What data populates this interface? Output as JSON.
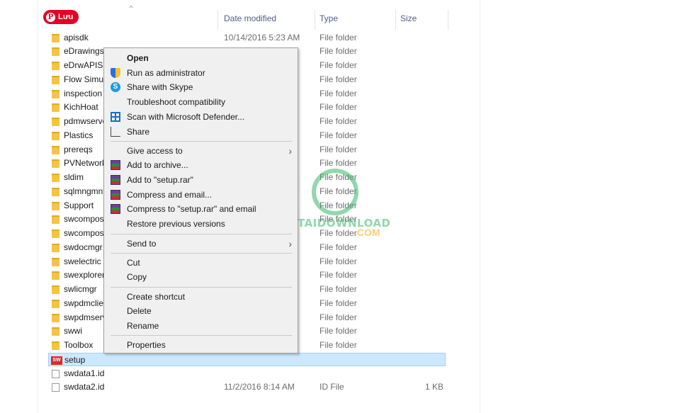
{
  "pin_button": {
    "label": "Lưu"
  },
  "columns": {
    "name": "",
    "date": "Date modified",
    "type": "Type",
    "size": "Size"
  },
  "files": [
    {
      "name": "apisdk",
      "date": "10/14/2016 5:23 AM",
      "type": "File folder",
      "size": "",
      "icon": "folder-icon"
    },
    {
      "name": "eDrawings",
      "date": "",
      "type": "File folder",
      "size": "",
      "icon": "folder-icon"
    },
    {
      "name": "eDrwAPISD",
      "date": "",
      "type": "File folder",
      "size": "",
      "icon": "folder-icon"
    },
    {
      "name": "Flow Simula",
      "date": "",
      "type": "File folder",
      "size": "",
      "icon": "folder-icon"
    },
    {
      "name": "inspection",
      "date": "",
      "type": "File folder",
      "size": "",
      "icon": "folder-icon"
    },
    {
      "name": "KichHoat",
      "date": "",
      "type": "File folder",
      "size": "",
      "icon": "folder-icon"
    },
    {
      "name": "pdmwserve",
      "date": "",
      "type": "File folder",
      "size": "",
      "icon": "folder-icon"
    },
    {
      "name": "Plastics",
      "date": "",
      "type": "File folder",
      "size": "",
      "icon": "folder-icon"
    },
    {
      "name": "prereqs",
      "date": "",
      "type": "File folder",
      "size": "",
      "icon": "folder-icon"
    },
    {
      "name": "PVNetwork",
      "date": "",
      "type": "File folder",
      "size": "",
      "icon": "folder-icon"
    },
    {
      "name": "sldim",
      "date": "",
      "type": "File folder",
      "size": "",
      "icon": "folder-icon"
    },
    {
      "name": "sqlmngmnt",
      "date": "",
      "type": "File folder",
      "size": "",
      "icon": "folder-icon"
    },
    {
      "name": "Support",
      "date": "",
      "type": "File folder",
      "size": "",
      "icon": "folder-icon"
    },
    {
      "name": "swcompose",
      "date": "",
      "type": "File folder",
      "size": "",
      "icon": "folder-icon"
    },
    {
      "name": "swcompose",
      "date": "",
      "type": "File folder",
      "size": "",
      "icon": "folder-icon"
    },
    {
      "name": "swdocmgr",
      "date": "",
      "type": "File folder",
      "size": "",
      "icon": "folder-icon"
    },
    {
      "name": "swelectric",
      "date": "",
      "type": "File folder",
      "size": "",
      "icon": "folder-icon"
    },
    {
      "name": "swexplorer",
      "date": "",
      "type": "File folder",
      "size": "",
      "icon": "folder-icon"
    },
    {
      "name": "swlicmgr",
      "date": "",
      "type": "File folder",
      "size": "",
      "icon": "folder-icon"
    },
    {
      "name": "swpdmclier",
      "date": "",
      "type": "File folder",
      "size": "",
      "icon": "folder-icon"
    },
    {
      "name": "swpdmserv",
      "date": "",
      "type": "File folder",
      "size": "",
      "icon": "folder-icon"
    },
    {
      "name": "swwi",
      "date": "",
      "type": "File folder",
      "size": "",
      "icon": "folder-icon"
    },
    {
      "name": "Toolbox",
      "date": "",
      "type": "File folder",
      "size": "",
      "icon": "folder-icon"
    },
    {
      "name": "setup",
      "date": "",
      "type": "",
      "size": "",
      "icon": "solidworks-setup-icon",
      "selected": true
    },
    {
      "name": "swdata1.id",
      "date": "",
      "type": "",
      "size": "",
      "icon": "file-icon"
    },
    {
      "name": "swdata2.id",
      "date": "11/2/2016 8:14 AM",
      "type": "ID File",
      "size": "1 KB",
      "icon": "file-icon"
    }
  ],
  "context_menu": {
    "open": "Open",
    "run_as_admin": "Run as administrator",
    "share_skype": "Share with Skype",
    "troubleshoot": "Troubleshoot compatibility",
    "scan_defender": "Scan with Microsoft Defender...",
    "share": "Share",
    "give_access": "Give access to",
    "add_archive": "Add to archive...",
    "add_setup_rar": "Add to \"setup.rar\"",
    "compress_email": "Compress and email...",
    "compress_setup_email": "Compress to \"setup.rar\" and email",
    "restore_versions": "Restore previous versions",
    "send_to": "Send to",
    "cut": "Cut",
    "copy": "Copy",
    "create_shortcut": "Create shortcut",
    "delete": "Delete",
    "rename": "Rename",
    "properties": "Properties"
  },
  "watermark": {
    "brand": "TAIDOWNLOAD",
    "suffix": ".COM"
  },
  "colors": {
    "selection": "#cce8ff",
    "pin": "#e60023",
    "watermark": "#39b86a"
  }
}
